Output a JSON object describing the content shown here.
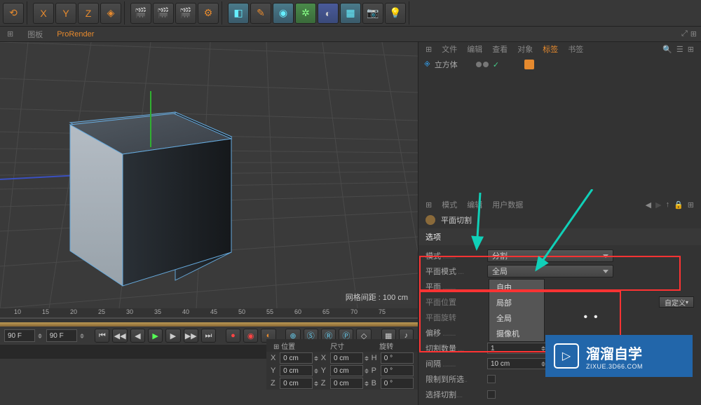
{
  "toolbar": {
    "axis": [
      "X",
      "Y",
      "Z"
    ]
  },
  "tabs": {
    "viewport_mode": "图板",
    "renderer": "ProRender"
  },
  "viewport": {
    "grid_info": "网格间距 : 100 cm"
  },
  "timeline": {
    "marks": [
      "10",
      "15",
      "20",
      "25",
      "30",
      "35",
      "40",
      "45",
      "50",
      "55",
      "60",
      "65",
      "70",
      "75"
    ],
    "start_frame": "90 F",
    "end_frame": "90 F"
  },
  "coords": {
    "headers": {
      "pos": "位置",
      "size": "尺寸",
      "rot": "旋转"
    },
    "x": {
      "label": "X",
      "pos": "0 cm",
      "size": "0 cm",
      "rot_label": "H",
      "rot": "0 °"
    },
    "y": {
      "label": "Y",
      "pos": "0 cm",
      "size": "0 cm",
      "rot_label": "P",
      "rot": "0 °"
    },
    "z": {
      "label": "Z",
      "pos": "0 cm",
      "size": "0 cm",
      "rot_label": "B",
      "rot": "0 °"
    }
  },
  "object_manager": {
    "tabs": {
      "file": "文件",
      "edit": "编辑",
      "view": "查看",
      "object": "对象",
      "tags": "标签",
      "bookmarks": "书签"
    },
    "item": {
      "name": "立方体"
    }
  },
  "attributes": {
    "tabs": {
      "mode": "模式",
      "edit": "编辑",
      "userdata": "用户数据"
    },
    "tool_name": "平面切割",
    "section": "选项",
    "rows": {
      "mode": {
        "label": "模式",
        "value": "分割"
      },
      "plane_mode": {
        "label": "平面模式",
        "value": "全局"
      },
      "plane": {
        "label": "平面"
      },
      "plane_pos": {
        "label": "平面位置"
      },
      "plane_rot": {
        "label": "平面旋转"
      },
      "offset": {
        "label": "偏移"
      },
      "cuts": {
        "label": "切割数量",
        "value": "1"
      },
      "gap": {
        "label": "间隔",
        "value": "10 cm"
      },
      "limit_sel": {
        "label": "限制到所选"
      },
      "sel_cut": {
        "label": "选择切割"
      },
      "custom": {
        "label": "自定义"
      }
    },
    "dropdown": {
      "opt1": "自由",
      "opt2": "局部",
      "opt3": "全局",
      "opt4": "摄像机"
    }
  },
  "watermark": {
    "title": "溜溜自学",
    "sub": "ZIXUE.3D66.COM"
  }
}
